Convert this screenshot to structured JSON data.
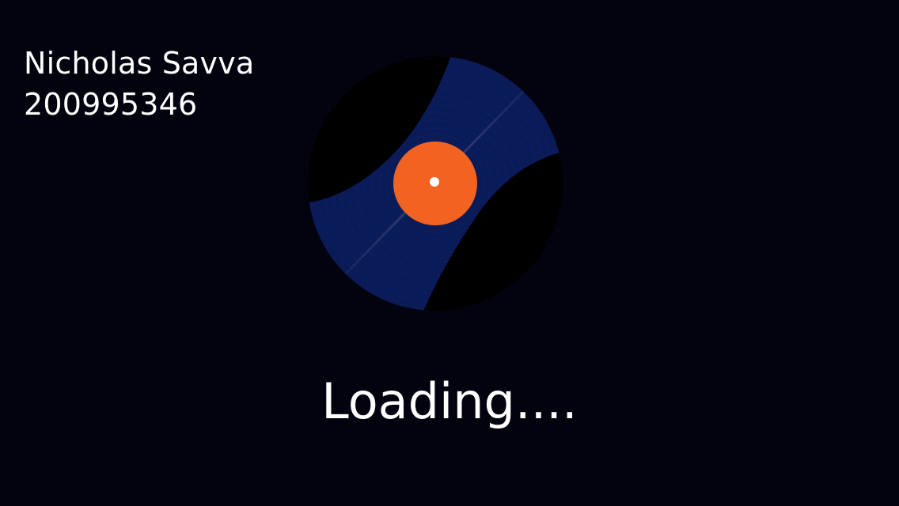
{
  "credits": {
    "name": "Nicholas Savva",
    "student_id": "200995346"
  },
  "loading": {
    "text": "Loading...."
  },
  "vinyl": {
    "icon": "vinyl-record-icon",
    "colors": {
      "background": "#03030f",
      "record_black": "#000000",
      "record_blue": "#0a1b57",
      "label_orange": "#f26322",
      "spindle": "#ffffff"
    }
  }
}
